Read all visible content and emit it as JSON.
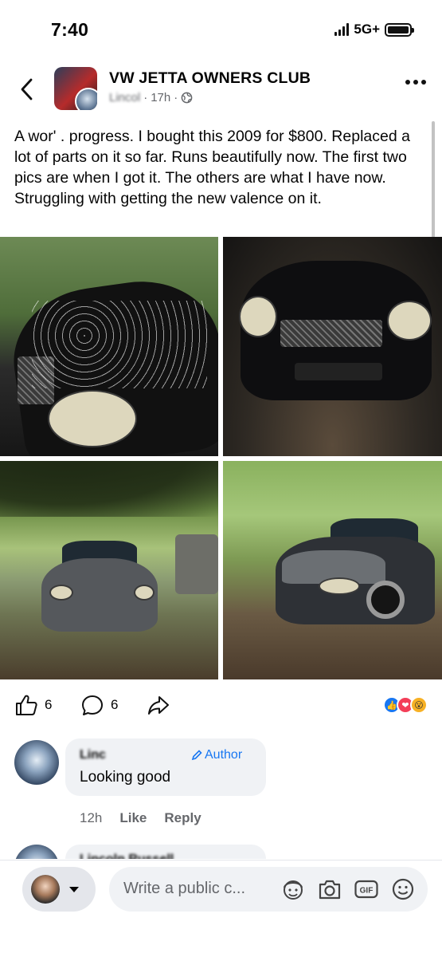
{
  "status_bar": {
    "time": "7:40",
    "network": "5G+"
  },
  "header": {
    "group_name": "VW JETTA OWNERS CLUB",
    "author": "Lincol",
    "time_ago": "17h",
    "separator": "·"
  },
  "post": {
    "text": "A wor'   . progress. I bought this 2009 for $800. Replaced a lot of parts on it so far. Runs beautifully now. The first two pics are when I got it. The others are what I have now. Struggling with getting the new valence on it."
  },
  "reactions": {
    "like_count": "6",
    "comment_count": "6",
    "emojis": [
      "like",
      "love",
      "wow"
    ]
  },
  "comment": {
    "author": "Linc",
    "badge": "Author",
    "text": "Looking good",
    "time": "12h",
    "like_label": "Like",
    "reply_label": "Reply"
  },
  "comment2": {
    "author": "Lincoln Russell"
  },
  "composer": {
    "placeholder": "Write a public c..."
  },
  "colors": {
    "accent": "#1877f2",
    "secondary_text": "#65676b",
    "bubble": "#f0f2f5"
  }
}
